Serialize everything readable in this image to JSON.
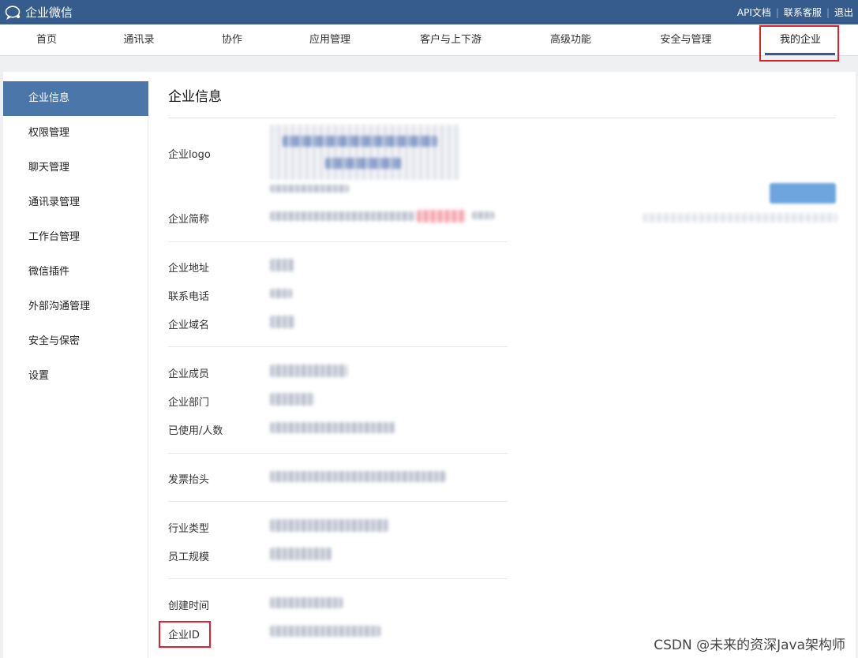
{
  "header": {
    "app_title": "企业微信",
    "links": [
      "API文档",
      "联系客服",
      "退出"
    ]
  },
  "nav": {
    "items": [
      "首页",
      "通讯录",
      "协作",
      "应用管理",
      "客户与上下游",
      "高级功能",
      "安全与管理",
      "我的企业"
    ],
    "active": "我的企业"
  },
  "sidebar": {
    "items": [
      "企业信息",
      "权限管理",
      "聊天管理",
      "通讯录管理",
      "工作台管理",
      "微信插件",
      "外部沟通管理",
      "安全与保密",
      "设置"
    ],
    "active": "企业信息"
  },
  "main": {
    "title": "企业信息",
    "fields": {
      "logo": "企业logo",
      "short_name": "企业简称",
      "address": "企业地址",
      "phone": "联系电话",
      "domain": "企业域名",
      "members": "企业成员",
      "departments": "企业部门",
      "used_seats": "已使用/人数",
      "invoice": "发票抬头",
      "industry": "行业类型",
      "scale": "员工规模",
      "created": "创建时间",
      "corp_id": "企业ID"
    }
  },
  "watermark": "CSDN @未来的资深Java架构师",
  "colors": {
    "header_bg": "#355c8d",
    "sidebar_active": "#4a76aa",
    "highlight_red": "#e0212d"
  }
}
